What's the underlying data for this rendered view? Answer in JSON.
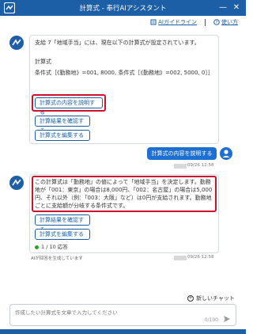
{
  "window": {
    "title": "計算式 - 奉行AIアシスタント",
    "minimize_label": "—",
    "close_label": "✕"
  },
  "toolbar": {
    "guideline_label": "AIガイドライン",
    "howto_label": "使い方"
  },
  "messages": {
    "bot1": {
      "line1": "支給 7「地域手当」には、現在以下の計算式が設定されています。",
      "heading": "計算式",
      "formula": "条件式［《勤務地》=001, 8000, 条件式［《勤務地》=002, 5000, 0］］",
      "buttons": [
        "計算式の内容を説明する",
        "計算結果を確認する",
        "計算式を編集する"
      ]
    },
    "user1": {
      "text": "計算式の内容を説明する",
      "timestamp": "09/26 12:58"
    },
    "bot2": {
      "text": "この計算式は「勤務地」の値によって「地域手当」を決定します。勤務地が「001：東京」の場合は8,000円、「002：名古屋」の場合は5,000円、それ以外（例：「003：大阪」など）は0円が支給されます。勤務地ごとに支給額が分岐する条件式です。",
      "buttons": [
        "計算結果を確認する",
        "計算式を編集する"
      ],
      "rating": "1 / 10 応答",
      "timestamp": "09/26 12:58",
      "disclaimer": "AIが回答を生成しています"
    }
  },
  "new_chat_label": "新しいチャット",
  "input": {
    "placeholder": "作成したい計算式を文章で入力してください",
    "counter": "0/100"
  },
  "colors": {
    "brand": "#1d5fa6",
    "user_bubble": "#1d6fd1",
    "highlight": "#d0112b"
  }
}
